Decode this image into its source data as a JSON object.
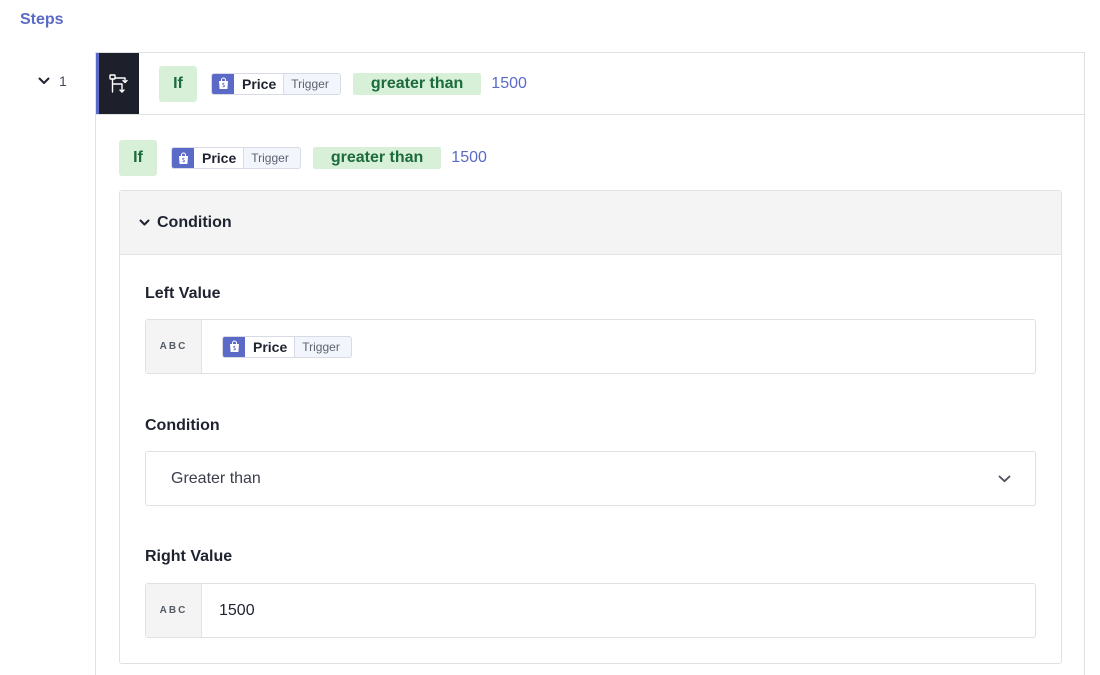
{
  "steps_title": "Steps",
  "step": {
    "index": "1",
    "header": {
      "if_label": "If",
      "token_name": "Price",
      "token_source": "Trigger",
      "operator": "greater than",
      "value": "1500"
    },
    "summary": {
      "if_label": "If",
      "token_name": "Price",
      "token_source": "Trigger",
      "operator": "greater than",
      "value": "1500"
    },
    "condition_panel": {
      "title": "Condition",
      "left_value": {
        "label": "Left Value",
        "type_tag": "ABC",
        "token_name": "Price",
        "token_source": "Trigger"
      },
      "condition": {
        "label": "Condition",
        "selected": "Greater than"
      },
      "right_value": {
        "label": "Right Value",
        "type_tag": "ABC",
        "value": "1500"
      }
    }
  },
  "colors": {
    "accent": "#5b6ac6",
    "chip_green_bg": "#d8f0d7",
    "chip_green_text": "#1b6b3c",
    "dark_icon_bg": "#1d1f2a"
  },
  "icons": {
    "step": "branch-condition-icon",
    "token": "shopify-bag-icon",
    "collapse": "chevron-down-icon",
    "dropdown": "chevron-down-icon"
  }
}
